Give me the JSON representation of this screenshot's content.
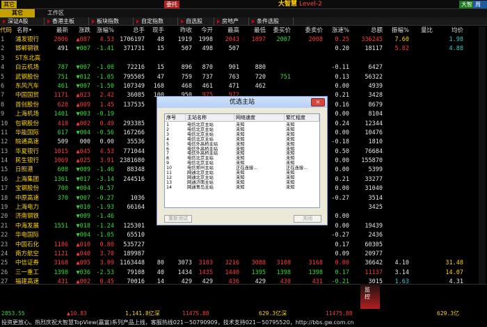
{
  "app": {
    "brand": "大智慧",
    "brand_level": "Level-2",
    "top_left_badge": "其它",
    "top_left_badge2": "委托",
    "top_right_badges": [
      "大智",
      "周期"
    ]
  },
  "tabs": {
    "active": "其它",
    "work": "工作区"
  },
  "categories": [
    "深证A股",
    "香港主板",
    "板块指数",
    "自定指数",
    "自选股",
    "房地产",
    "条件选股"
  ],
  "headers": [
    "代码",
    "名称•",
    "最新",
    "涨跌",
    "涨幅%",
    "总手",
    "现手",
    "昨收",
    "今开",
    "最高",
    "最低",
    "委买价",
    "委卖价",
    "涨速%",
    "总额",
    "振幅%",
    "量比",
    "均价"
  ],
  "rows": [
    {
      "code": "",
      "name": "浦发银行",
      "last": "2806",
      "chg": "▲087",
      "pct": "4.53",
      "vol": "1706197",
      "cur": "48",
      "prev": "1919",
      "open": "1998",
      "high": "2043",
      "low": "1897",
      "bid": "2007",
      "ask": "2008",
      "spd": "0.25",
      "amt": "336245",
      "amp": "7.60",
      "vr": "",
      "avg": "1.98",
      "c": [
        "up",
        "up",
        "up",
        "wh",
        "wh",
        "wh",
        "wh",
        "up",
        "up",
        "dn",
        "up",
        "up",
        "up",
        "yl",
        "up",
        "cy",
        "yl"
      ]
    },
    {
      "code": "",
      "name": "邯郸钢铁",
      "last": "491",
      "prev": "507",
      "chg": "▼007",
      "pct": "-1.41",
      "vol": "371731",
      "cur": "15",
      "open": "498",
      "high": "507",
      "low": "",
      "bid": "",
      "ask": "",
      "spd": "0.20",
      "amt": "18117",
      "amp": "5.82",
      "vr": "",
      "avg": "4.88",
      "c": [
        "wh",
        "dn",
        "dn",
        "wh",
        "wh",
        "wh",
        "wh",
        "wh",
        "wh",
        "",
        "",
        "",
        "",
        "up",
        "wh",
        "cy",
        "yl"
      ]
    },
    {
      "code": "",
      "name": "ST东北高",
      "last": "",
      "chg": "",
      "pct": "",
      "vol": "",
      "cur": "",
      "prev": "",
      "open": "",
      "high": "",
      "low": "",
      "bid": "",
      "ask": "",
      "spd": "",
      "amt": "",
      "amp": "",
      "vr": "",
      "avg": "",
      "c": []
    },
    {
      "code": "",
      "name": "白云机场",
      "last": "787",
      "chg": "▼007",
      "pct": "-1.00",
      "vol": "72216",
      "cur": "15",
      "prev": "896",
      "open": "870",
      "high": "901",
      "low": "880",
      "bid": "",
      "ask": "",
      "spd": "-0.11",
      "amt": "6427",
      "amp": "",
      "vr": "",
      "avg": "",
      "c": [
        "dn",
        "dn",
        "dn",
        "wh",
        "wh",
        "wh",
        "wh",
        "wh",
        "wh",
        "",
        "",
        "",
        "",
        "dn",
        "wh",
        "",
        "yl"
      ]
    },
    {
      "code": "",
      "name": "武钢股份",
      "last": "751",
      "chg": "▼012",
      "pct": "-1.05",
      "vol": "795505",
      "cur": "47",
      "prev": "759",
      "open": "737",
      "high": "763",
      "low": "720",
      "bid": "751",
      "ask": "",
      "spd": "0.13",
      "amt": "56322",
      "amp": "",
      "vr": "",
      "avg": "",
      "c": [
        "dn",
        "dn",
        "dn",
        "wh",
        "wh",
        "wh",
        "wh",
        "wh",
        "wh",
        "dn",
        "",
        "",
        "",
        "up",
        "wh",
        "",
        "yl"
      ]
    },
    {
      "code": "",
      "name": "东风汽车",
      "last": "461",
      "chg": "▼007",
      "pct": "-1.50",
      "vol": "107349",
      "cur": "168",
      "prev": "468",
      "open": "461",
      "high": "471",
      "low": "462",
      "bid": "",
      "ask": "",
      "spd": "0.00",
      "amt": "4939",
      "amp": "",
      "vr": "",
      "avg": "",
      "c": [
        "dn",
        "dn",
        "dn",
        "wh",
        "wh",
        "wh",
        "wh",
        "wh",
        "wh",
        "",
        "",
        "",
        "",
        "wh",
        "wh",
        "",
        "yl"
      ]
    },
    {
      "code": "",
      "name": "中国国贸",
      "last": "1171",
      "chg": "▲023",
      "pct": "2.42",
      "vol": "36085",
      "cur": "100",
      "prev": "950",
      "open": "975",
      "high": "972",
      "low": "",
      "bid": "",
      "ask": "",
      "spd": "0.21",
      "amt": "3428",
      "amp": "",
      "vr": "",
      "avg": "",
      "c": [
        "up",
        "up",
        "up",
        "wh",
        "wh",
        "wh",
        "up",
        "up",
        "",
        "",
        "",
        "",
        "",
        "up",
        "wh",
        "",
        "yl"
      ]
    },
    {
      "code": "",
      "name": "首创股份",
      "last": "628",
      "chg": "▲009",
      "pct": "1.45",
      "vol": "137535",
      "cur": "",
      "prev": "",
      "open": "",
      "high": "",
      "low": "",
      "bid": "",
      "ask": "",
      "spd": "0.16",
      "amt": "8679",
      "amp": "",
      "vr": "",
      "avg": "",
      "c": [
        "up",
        "up",
        "up",
        "wh",
        "",
        "",
        "",
        "",
        "",
        "",
        "",
        "",
        "",
        "up",
        "wh",
        "",
        "yl"
      ]
    },
    {
      "code": "",
      "name": "上海机场",
      "last": "1401",
      "chg": "▼003",
      "pct": "-0.19",
      "vol": "",
      "cur": "",
      "prev": "",
      "open": "",
      "high": "",
      "low": "",
      "bid": "",
      "ask": "",
      "spd": "0.00",
      "amt": "8104",
      "amp": "",
      "vr": "",
      "avg": "",
      "c": [
        "dn",
        "dn",
        "dn",
        "",
        "",
        "",
        "",
        "",
        "",
        "",
        "",
        "",
        "",
        "wh",
        "wh",
        "",
        "yl"
      ]
    },
    {
      "code": "",
      "name": "包钢股份",
      "last": "418",
      "chg": "▲002",
      "pct": "0.49",
      "vol": "293385",
      "cur": "",
      "prev": "",
      "open": "",
      "high": "",
      "low": "",
      "bid": "",
      "ask": "",
      "spd": "0.24",
      "amt": "12344",
      "amp": "",
      "vr": "",
      "avg": "",
      "c": [
        "up",
        "up",
        "up",
        "wh",
        "",
        "",
        "",
        "",
        "",
        "",
        "",
        "",
        "",
        "up",
        "wh",
        "",
        "yl"
      ]
    },
    {
      "code": "",
      "name": "华能国际",
      "last": "617",
      "chg": "▼004",
      "pct": "-0.56",
      "vol": "167266",
      "cur": "",
      "prev": "",
      "open": "",
      "high": "",
      "low": "",
      "bid": "",
      "ask": "",
      "spd": "0.00",
      "amt": "10476",
      "amp": "",
      "vr": "",
      "avg": "",
      "c": [
        "dn",
        "dn",
        "dn",
        "wh",
        "",
        "",
        "",
        "",
        "",
        "",
        "",
        "",
        "",
        "wh",
        "wh",
        "",
        "yl"
      ]
    },
    {
      "code": "",
      "name": "皖通高速",
      "last": "509",
      "chg": "000",
      "pct": "0.00",
      "vol": "35536",
      "cur": "",
      "prev": "",
      "open": "",
      "high": "",
      "low": "",
      "bid": "",
      "ask": "",
      "spd": "-0.18",
      "amt": "1810",
      "amp": "",
      "vr": "",
      "avg": "",
      "c": [
        "wh",
        "wh",
        "wh",
        "wh",
        "",
        "",
        "",
        "",
        "",
        "",
        "",
        "",
        "",
        "dn",
        "wh",
        "",
        "yl"
      ]
    },
    {
      "code": "",
      "name": "华夏银行",
      "last": "1015",
      "chg": "▲045",
      "pct": "4.53",
      "vol": "771044",
      "cur": "",
      "prev": "",
      "open": "",
      "high": "",
      "low": "",
      "bid": "",
      "ask": "",
      "spd": "0.50",
      "amt": "76684",
      "amp": "",
      "vr": "",
      "avg": "",
      "c": [
        "up",
        "up",
        "up",
        "wh",
        "",
        "",
        "",
        "",
        "",
        "",
        "",
        "",
        "",
        "up",
        "wh",
        "",
        "yl"
      ]
    },
    {
      "code": "",
      "name": "民生银行",
      "last": "1069",
      "chg": "▲025",
      "pct": "3.91",
      "vol": "2381680",
      "cur": "",
      "prev": "",
      "open": "",
      "high": "",
      "low": "",
      "bid": "",
      "ask": "",
      "spd": "0.00",
      "amt": "155870",
      "amp": "",
      "vr": "",
      "avg": "",
      "c": [
        "up",
        "up",
        "up",
        "wh",
        "",
        "",
        "",
        "",
        "",
        "",
        "",
        "",
        "",
        "wh",
        "wh",
        "",
        "yl"
      ]
    },
    {
      "code": "",
      "name": "日照港",
      "last": "608",
      "chg": "▼009",
      "pct": "-1.46",
      "vol": "88348",
      "cur": "",
      "prev": "",
      "open": "",
      "high": "",
      "low": "",
      "bid": "",
      "ask": "",
      "spd": "0.00",
      "amt": "5399",
      "amp": "",
      "vr": "",
      "avg": "",
      "c": [
        "dn",
        "dn",
        "dn",
        "wh",
        "",
        "",
        "",
        "",
        "",
        "",
        "",
        "",
        "",
        "wh",
        "wh",
        "",
        "yl"
      ]
    },
    {
      "code": "",
      "name": "上海集团",
      "last": "1361",
      "chg": "▼017",
      "pct": "-3.14",
      "vol": "244516",
      "cur": "",
      "prev": "",
      "open": "",
      "high": "",
      "low": "",
      "bid": "",
      "ask": "",
      "spd": "0.21",
      "amt": "33277",
      "amp": "",
      "vr": "",
      "avg": "",
      "c": [
        "dn",
        "dn",
        "dn",
        "wh",
        "",
        "",
        "",
        "",
        "",
        "",
        "",
        "",
        "",
        "up",
        "wh",
        "",
        "yl"
      ]
    },
    {
      "code": "",
      "name": "宝钢股份",
      "last": "700",
      "chg": "▼004",
      "pct": "-0.57",
      "vol": "",
      "cur": "",
      "prev": "",
      "open": "",
      "high": "",
      "low": "",
      "bid": "",
      "ask": "",
      "spd": "0.00",
      "amt": "31040",
      "amp": "",
      "vr": "",
      "avg": "",
      "c": [
        "dn",
        "dn",
        "dn",
        "",
        "",
        "",
        "",
        "",
        "",
        "",
        "",
        "",
        "",
        "wh",
        "wh",
        "",
        "yl"
      ]
    },
    {
      "code": "",
      "name": "中原高速",
      "last": "370",
      "chg": "▼007",
      "pct": "-0.27",
      "vol": "1036",
      "cur": "",
      "prev": "",
      "open": "",
      "high": "",
      "low": "",
      "bid": "",
      "ask": "",
      "spd": "-0.27",
      "amt": "3514",
      "amp": "",
      "vr": "",
      "avg": "",
      "c": [
        "dn",
        "dn",
        "dn",
        "wh",
        "",
        "",
        "",
        "",
        "",
        "",
        "",
        "",
        "",
        "dn",
        "wh",
        "",
        "yl"
      ]
    },
    {
      "code": "",
      "name": "上海电力",
      "last": "",
      "chg": "▼010",
      "pct": "-1.93",
      "vol": "66164",
      "cur": "",
      "prev": "",
      "open": "",
      "high": "",
      "low": "",
      "bid": "",
      "ask": "",
      "spd": "",
      "amt": "3425",
      "amp": "",
      "vr": "",
      "avg": "",
      "c": [
        "",
        "dn",
        "dn",
        "wh",
        "",
        "",
        "",
        "",
        "",
        "",
        "",
        "",
        "",
        "",
        "wh",
        "",
        "yl"
      ]
    },
    {
      "code": "",
      "name": "济南钢铁",
      "last": "",
      "chg": "▼009",
      "pct": "-1.46",
      "vol": "",
      "cur": "",
      "prev": "",
      "open": "",
      "high": "",
      "low": "",
      "bid": "",
      "ask": "",
      "spd": "0.00",
      "amt": "",
      "amp": "",
      "vr": "",
      "avg": "",
      "c": [
        "",
        "dn",
        "dn",
        "",
        "",
        "",
        "",
        "",
        "",
        "",
        "",
        "",
        "",
        "wh",
        "",
        "",
        ""
      ]
    },
    {
      "code": "",
      "name": "中海发展",
      "last": "1551",
      "chg": "▼018",
      "pct": "-1.24",
      "vol": "125301",
      "cur": "",
      "prev": "",
      "open": "",
      "high": "",
      "low": "",
      "bid": "",
      "ask": "",
      "spd": "0.00",
      "amt": "19439",
      "amp": "",
      "vr": "",
      "avg": "",
      "c": [
        "dn",
        "dn",
        "dn",
        "wh",
        "",
        "",
        "",
        "",
        "",
        "",
        "",
        "",
        "",
        "wh",
        "wh",
        "",
        "yl"
      ]
    },
    {
      "code": "",
      "name": "华电国际",
      "last": "",
      "chg": "▼004",
      "pct": "-1.05",
      "vol": "65510",
      "cur": "",
      "prev": "",
      "open": "",
      "high": "",
      "low": "",
      "bid": "",
      "ask": "",
      "spd": "-0.27",
      "amt": "2436",
      "amp": "",
      "vr": "",
      "avg": "",
      "c": [
        "",
        "dn",
        "dn",
        "wh",
        "",
        "",
        "",
        "",
        "",
        "",
        "",
        "",
        "",
        "dn",
        "wh",
        "",
        "yl"
      ]
    },
    {
      "code": "",
      "name": "中国石化",
      "last": "1186",
      "chg": "▲010",
      "pct": "0.80",
      "vol": "535727",
      "cur": "",
      "prev": "",
      "open": "",
      "high": "",
      "low": "",
      "bid": "",
      "ask": "",
      "spd": "0.17",
      "amt": "60305",
      "amp": "",
      "vr": "",
      "avg": "",
      "c": [
        "up",
        "up",
        "up",
        "wh",
        "",
        "",
        "",
        "",
        "",
        "",
        "",
        "",
        "",
        "up",
        "wh",
        "",
        "yl"
      ]
    },
    {
      "code": "",
      "name": "南方航空",
      "last": "1121",
      "chg": "▲040",
      "pct": "3.70",
      "vol": "189987",
      "cur": "",
      "prev": "",
      "open": "",
      "high": "",
      "low": "",
      "bid": "",
      "ask": "",
      "spd": "0.09",
      "amt": "20977",
      "amp": "",
      "vr": "",
      "avg": "",
      "c": [
        "up",
        "up",
        "up",
        "wh",
        "",
        "",
        "",
        "",
        "",
        "",
        "",
        "",
        "",
        "up",
        "wh",
        "",
        "yl"
      ]
    },
    {
      "code": "",
      "name": "中信证券",
      "last": "3168",
      "chg": "▲095",
      "pct": "3.09",
      "vol": "1163448",
      "cur": "80",
      "prev": "3073",
      "open": "3103",
      "high": "3216",
      "low": "3088",
      "bid": "3108",
      "ask": "3168",
      "spd": "0.00",
      "amt": "36642",
      "amp": "4.10",
      "vr": "",
      "avg": "31.48",
      "c": [
        "up",
        "up",
        "up",
        "wh",
        "wh",
        "wh",
        "up",
        "up",
        "up",
        "up",
        "up",
        "up",
        "wh",
        "wh",
        "cy",
        "yl"
      ]
    },
    {
      "code": "",
      "name": "三一重工",
      "last": "1398",
      "chg": "▼036",
      "pct": "-2.53",
      "vol": "79108",
      "cur": "40",
      "prev": "1434",
      "open": "1435",
      "high": "1440",
      "low": "1395",
      "bid": "1398",
      "ask": "1398",
      "spd": "0.17",
      "amt": "11137",
      "amp": "3.14",
      "vr": "",
      "avg": "14.07",
      "c": [
        "dn",
        "dn",
        "dn",
        "wh",
        "wh",
        "wh",
        "up",
        "up",
        "dn",
        "dn",
        "dn",
        "dn",
        "up",
        "wh",
        "cy",
        "yl"
      ]
    },
    {
      "code": "",
      "name": "福建高速",
      "last": "431",
      "chg": "▲002",
      "pct": "0.45",
      "vol": "70016",
      "cur": "14",
      "prev": "429",
      "open": "429",
      "high": "436",
      "low": "429",
      "bid": "430",
      "ask": "431",
      "spd": "-0.21",
      "amt": "3015",
      "amp": "1.63",
      "vr": "",
      "avg": "4.31",
      "c": [
        "up",
        "up",
        "up",
        "wh",
        "wh",
        "wh",
        "wh",
        "up",
        "wh",
        "up",
        "up",
        "dn",
        "wh",
        "cy",
        "yl"
      ]
    },
    {
      "code": "",
      "name": "楚天高速",
      "last": "378",
      "chg": "▲002",
      "pct": "0.53",
      "vol": "37840",
      "cur": "40",
      "prev": "376",
      "open": "373",
      "high": "381",
      "low": "373",
      "bid": "377",
      "ask": "378",
      "spd": "0.26",
      "amt": "1429",
      "amp": "2.13",
      "vr": "",
      "avg": "3.78",
      "c": [
        "up",
        "up",
        "up",
        "wh",
        "wh",
        "wh",
        "dn",
        "up",
        "dn",
        "up",
        "up",
        "up",
        "wh",
        "cy",
        "yl"
      ]
    },
    {
      "code": "",
      "name": "招商银行",
      "last": "1898",
      "chg": "▲050",
      "pct": "2.60",
      "vol": "1038744",
      "cur": "68",
      "prev": "1848",
      "open": "1850",
      "high": "1910",
      "low": "1840",
      "bid": "1897",
      "ask": "1898",
      "spd": "0.05",
      "amt": "195120",
      "amp": "3.79",
      "vr": "",
      "avg": "18.78",
      "c": [
        "up",
        "up",
        "up",
        "wh",
        "wh",
        "wh",
        "up",
        "up",
        "dn",
        "up",
        "up",
        "up",
        "wh",
        "cy",
        "yl"
      ]
    }
  ],
  "dialog": {
    "title": "优选主站",
    "close": "×",
    "cols": [
      "序号",
      "主站名称",
      "网络速度",
      "繁忙程度"
    ],
    "items": [
      [
        "1",
        "电信北京主站",
        "未知",
        "未知"
      ],
      [
        "2",
        "电信北京主站",
        "未知",
        "未知"
      ],
      [
        "3",
        "电信北京主站",
        "未知",
        "未知"
      ],
      [
        "4",
        "电信北京主站",
        "未知",
        "未知"
      ],
      [
        "5",
        "电信外高桥主站",
        "未知",
        "未知"
      ],
      [
        "6",
        "电信外高桥主站",
        "未知",
        "未知"
      ],
      [
        "7",
        "电信外高桥主站",
        "未知",
        "未知"
      ],
      [
        "8",
        "电信北京主站",
        "未知",
        "未知"
      ],
      [
        "9",
        "电信北京主站",
        "未知",
        "未知"
      ],
      [
        "10",
        "电信郑州主站",
        "正在连接...",
        "正在连接..."
      ],
      [
        "11",
        "网通北京主站",
        "未知",
        "未知"
      ],
      [
        "12",
        "网通北京主站",
        "未知",
        "未知"
      ],
      [
        "13",
        "网通济南主站",
        "未知",
        "未知"
      ],
      [
        "14",
        "网通青岛主站",
        "未知",
        "未知"
      ]
    ],
    "btn_retest": "重新测试",
    "btn_close": "关闭"
  },
  "indices": [
    {
      "t": "2853.55",
      "c": "dn"
    },
    {
      "t": "▲10.83",
      "c": "up"
    },
    {
      "t": "1,141.8亿深",
      "c": "yl"
    },
    {
      "t": "11475.88",
      "c": "up"
    },
    {
      "t": "629.3亿深",
      "c": "yl"
    },
    {
      "t": "11475.88",
      "c": "up"
    },
    {
      "t": "629.3亿",
      "c": "yl"
    }
  ],
  "mini_widget": "监控",
  "ticker": "投资更放心。热烈庆祝大智慧TopView(赢富)系列产品上线，客服热线021－50790909，技术支持021－50795520，http://bbs.gw.com.cn"
}
